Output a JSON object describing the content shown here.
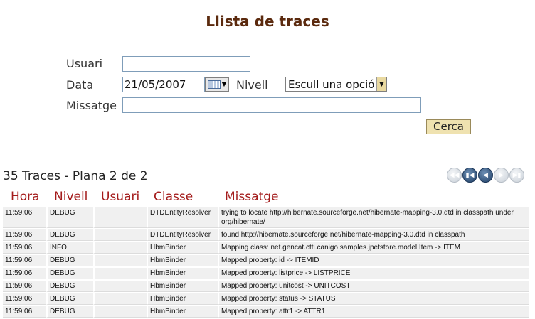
{
  "page": {
    "title": "Llista de traces"
  },
  "form": {
    "usuari_label": "Usuari",
    "usuari_value": "",
    "data_label": "Data",
    "data_value": "21/05/2007",
    "nivell_label": "Nivell",
    "nivell_selected": "Escull una opció",
    "missatge_label": "Missatge",
    "missatge_value": "",
    "search_label": "Cerca"
  },
  "results": {
    "summary": "35 Traces - Plana 2 de 2"
  },
  "table": {
    "headers": {
      "hora": "Hora",
      "nivell": "Nivell",
      "usuari": "Usuari",
      "classe": "Classe",
      "missatge": "Missatge"
    },
    "rows": [
      {
        "hora": "11:59:06",
        "nivell": "DEBUG",
        "usuari": "",
        "classe": "DTDEntityResolver",
        "missatge": "trying to locate http://hibernate.sourceforge.net/hibernate-mapping-3.0.dtd in classpath under org/hibernate/"
      },
      {
        "hora": "11:59:06",
        "nivell": "DEBUG",
        "usuari": "",
        "classe": "DTDEntityResolver",
        "missatge": "found http://hibernate.sourceforge.net/hibernate-mapping-3.0.dtd in classpath"
      },
      {
        "hora": "11:59:06",
        "nivell": "INFO",
        "usuari": "",
        "classe": "HbmBinder",
        "missatge": "Mapping class: net.gencat.ctti.canigo.samples.jpetstore.model.Item -> ITEM"
      },
      {
        "hora": "11:59:06",
        "nivell": "DEBUG",
        "usuari": "",
        "classe": "HbmBinder",
        "missatge": "Mapped property: id -> ITEMID"
      },
      {
        "hora": "11:59:06",
        "nivell": "DEBUG",
        "usuari": "",
        "classe": "HbmBinder",
        "missatge": "Mapped property: listprice -> LISTPRICE"
      },
      {
        "hora": "11:59:06",
        "nivell": "DEBUG",
        "usuari": "",
        "classe": "HbmBinder",
        "missatge": "Mapped property: unitcost -> UNITCOST"
      },
      {
        "hora": "11:59:06",
        "nivell": "DEBUG",
        "usuari": "",
        "classe": "HbmBinder",
        "missatge": "Mapped property: status -> STATUS"
      },
      {
        "hora": "11:59:06",
        "nivell": "DEBUG",
        "usuari": "",
        "classe": "HbmBinder",
        "missatge": "Mapped property: attr1 -> ATTR1"
      }
    ]
  },
  "icons": {
    "calendar": "calendar-icon",
    "pager": [
      "first-page-icon",
      "first-page-icon",
      "previous-page-icon",
      "next-page-icon",
      "last-page-icon"
    ]
  },
  "colors": {
    "title": "#5b2a0e",
    "header_text": "#a41c1c",
    "button_bg": "#efe2b0",
    "row_bg": "#f0f0f0"
  }
}
